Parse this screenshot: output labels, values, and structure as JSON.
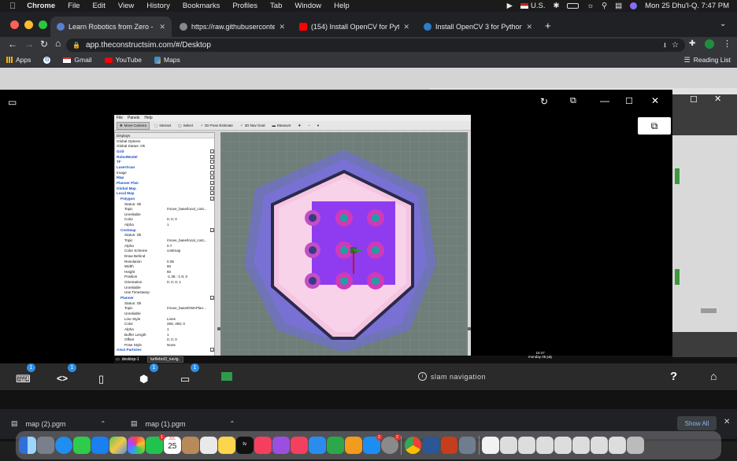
{
  "menubar": {
    "app": "Chrome",
    "items": [
      "File",
      "Edit",
      "View",
      "History",
      "Bookmarks",
      "Profiles",
      "Tab",
      "Window",
      "Help"
    ],
    "keyboard": "U.S.",
    "datetime": "Mon 25 Dhu'l-Q.  7:47 PM"
  },
  "tabs": [
    {
      "title": "Learn Robotics from Zero - Rob",
      "active": true,
      "color": "#5b7ed1"
    },
    {
      "title": "https://raw.githubusercontent.",
      "active": false,
      "color": "#888888"
    },
    {
      "title": "(154) Install OpenCV for Python",
      "active": false,
      "color": "#ff0000"
    },
    {
      "title": "Install OpenCV 3 for Python on",
      "active": false,
      "color": "#2a7fc9"
    }
  ],
  "url": "app.theconstructsim.com/#/Desktop",
  "bookmarks": [
    "Apps",
    "Gmail",
    "YouTube",
    "Maps"
  ],
  "reading_list": "Reading List",
  "rviz": {
    "menu": [
      "File",
      "Panels",
      "Help"
    ],
    "tools": [
      "Move Camera",
      "Interact",
      "Select",
      "2D Pose Estimate",
      "2D Nav Goal",
      "Measure"
    ],
    "displays_title": "Displays",
    "tree": [
      {
        "indent": 0,
        "name": "Global Options",
        "value": "",
        "blue": false,
        "check": ""
      },
      {
        "indent": 0,
        "name": "Global Status: Ok",
        "value": "",
        "blue": false,
        "check": ""
      },
      {
        "indent": 0,
        "name": "Grid",
        "value": "",
        "blue": true,
        "check": "✓"
      },
      {
        "indent": 0,
        "name": "RobotModel",
        "value": "",
        "blue": true,
        "check": "✓"
      },
      {
        "indent": 0,
        "name": "TF",
        "value": "",
        "blue": true,
        "check": ""
      },
      {
        "indent": 0,
        "name": "LaserScan",
        "value": "",
        "blue": true,
        "check": "✓"
      },
      {
        "indent": 0,
        "name": "Image",
        "value": "",
        "blue": false,
        "check": ""
      },
      {
        "indent": 0,
        "name": "Map",
        "value": "",
        "blue": true,
        "check": "✓"
      },
      {
        "indent": 0,
        "name": "Planner Plan",
        "value": "",
        "blue": true,
        "check": "✓"
      },
      {
        "indent": 0,
        "name": "Global Map",
        "value": "",
        "blue": true,
        "check": "✓"
      },
      {
        "indent": 0,
        "name": "Local Map",
        "value": "",
        "blue": true,
        "check": "✓"
      },
      {
        "indent": 1,
        "name": "Polygon",
        "value": "",
        "blue": true,
        "check": "✓"
      },
      {
        "indent": 2,
        "name": "Status: Ok",
        "value": "",
        "blue": false,
        "check": ""
      },
      {
        "indent": 2,
        "name": "Topic",
        "value": "/move_base/local_cost...",
        "blue": false,
        "check": ""
      },
      {
        "indent": 2,
        "name": "Unreliable",
        "value": "",
        "blue": false,
        "check": ""
      },
      {
        "indent": 2,
        "name": "Color",
        "value": "0; 0; 0",
        "blue": false,
        "check": ""
      },
      {
        "indent": 2,
        "name": "Alpha",
        "value": "1",
        "blue": false,
        "check": ""
      },
      {
        "indent": 1,
        "name": "Costmap",
        "value": "",
        "blue": true,
        "check": "✓"
      },
      {
        "indent": 2,
        "name": "Status: Ok",
        "value": "",
        "blue": false,
        "check": ""
      },
      {
        "indent": 2,
        "name": "Topic",
        "value": "/move_base/local_cost...",
        "blue": false,
        "check": ""
      },
      {
        "indent": 2,
        "name": "Alpha",
        "value": "0.7",
        "blue": false,
        "check": ""
      },
      {
        "indent": 2,
        "name": "Color Scheme",
        "value": "costmap",
        "blue": false,
        "check": ""
      },
      {
        "indent": 2,
        "name": "Draw Behind",
        "value": "",
        "blue": false,
        "check": ""
      },
      {
        "indent": 2,
        "name": "Resolution",
        "value": "0.05",
        "blue": false,
        "check": ""
      },
      {
        "indent": 2,
        "name": "Width",
        "value": "60",
        "blue": false,
        "check": ""
      },
      {
        "indent": 2,
        "name": "Height",
        "value": "60",
        "blue": false,
        "check": ""
      },
      {
        "indent": 2,
        "name": "Position",
        "value": "-1.35; -1.9; 0",
        "blue": false,
        "check": ""
      },
      {
        "indent": 2,
        "name": "Orientation",
        "value": "0; 0; 0; 1",
        "blue": false,
        "check": ""
      },
      {
        "indent": 2,
        "name": "Unreliable",
        "value": "",
        "blue": false,
        "check": ""
      },
      {
        "indent": 2,
        "name": "Use Timestamp",
        "value": "",
        "blue": false,
        "check": ""
      },
      {
        "indent": 1,
        "name": "Planner",
        "value": "",
        "blue": true,
        "check": "✓"
      },
      {
        "indent": 2,
        "name": "Status: Ok",
        "value": "",
        "blue": false,
        "check": ""
      },
      {
        "indent": 2,
        "name": "Topic",
        "value": "/move_base/DWAPlan...",
        "blue": false,
        "check": ""
      },
      {
        "indent": 2,
        "name": "Unreliable",
        "value": "",
        "blue": false,
        "check": ""
      },
      {
        "indent": 2,
        "name": "Line Style",
        "value": "Lines",
        "blue": false,
        "check": ""
      },
      {
        "indent": 2,
        "name": "Color",
        "value": "255; 255; 0",
        "blue": false,
        "check": ""
      },
      {
        "indent": 2,
        "name": "Alpha",
        "value": "1",
        "blue": false,
        "check": ""
      },
      {
        "indent": 2,
        "name": "Buffer Length",
        "value": "1",
        "blue": false,
        "check": ""
      },
      {
        "indent": 2,
        "name": "Offset",
        "value": "0; 0; 0",
        "blue": false,
        "check": ""
      },
      {
        "indent": 2,
        "name": "Pose Style",
        "value": "None",
        "blue": false,
        "check": ""
      },
      {
        "indent": 0,
        "name": "Amcl Particles",
        "value": "",
        "blue": true,
        "check": "✓"
      }
    ]
  },
  "vnc_taskbar": {
    "desktop": "desktop-1",
    "task": "turtlebot3_navig..",
    "time": "16:47",
    "date": "monday 05 july"
  },
  "bottom_bar": {
    "center_label": "slam navigation",
    "badges": [
      "1",
      "1",
      "1",
      "1"
    ]
  },
  "downloads": {
    "files": [
      "map (2).pgm",
      "map (1).pgm"
    ],
    "show_all": "Show All"
  },
  "dock": {
    "calendar_month": "JUL",
    "calendar_day": "25",
    "badges": [
      "1",
      "2",
      "2"
    ]
  }
}
